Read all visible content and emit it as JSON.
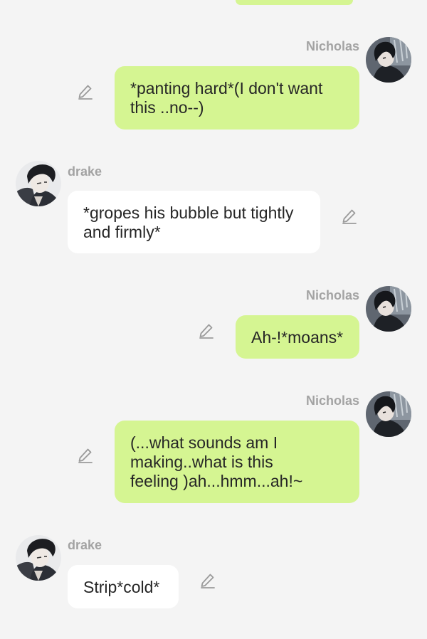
{
  "chat": {
    "messages": [
      {
        "sender": "Nicholas",
        "side": "right",
        "text": "*panting hard*(I don't want\nthis ..no--)"
      },
      {
        "sender": "drake",
        "side": "left",
        "text": "*gropes his bubble but tightly\nand firmly*"
      },
      {
        "sender": "Nicholas",
        "side": "right",
        "text": "Ah-!*moans*"
      },
      {
        "sender": "Nicholas",
        "side": "right",
        "text": "(...what sounds am I\nmaking..what is this\nfeeling )ah...hmm...ah!~"
      },
      {
        "sender": "drake",
        "side": "left",
        "text": "Strip*cold*"
      }
    ]
  },
  "icons": {
    "edit": "pencil-edit-icon",
    "avatar_nicholas": "nicholas-avatar",
    "avatar_drake": "drake-avatar"
  },
  "colors": {
    "sent_bubble": "#d5f592",
    "received_bubble": "#ffffff",
    "background": "#f4f4f4",
    "name_text": "#a3a3a3"
  }
}
